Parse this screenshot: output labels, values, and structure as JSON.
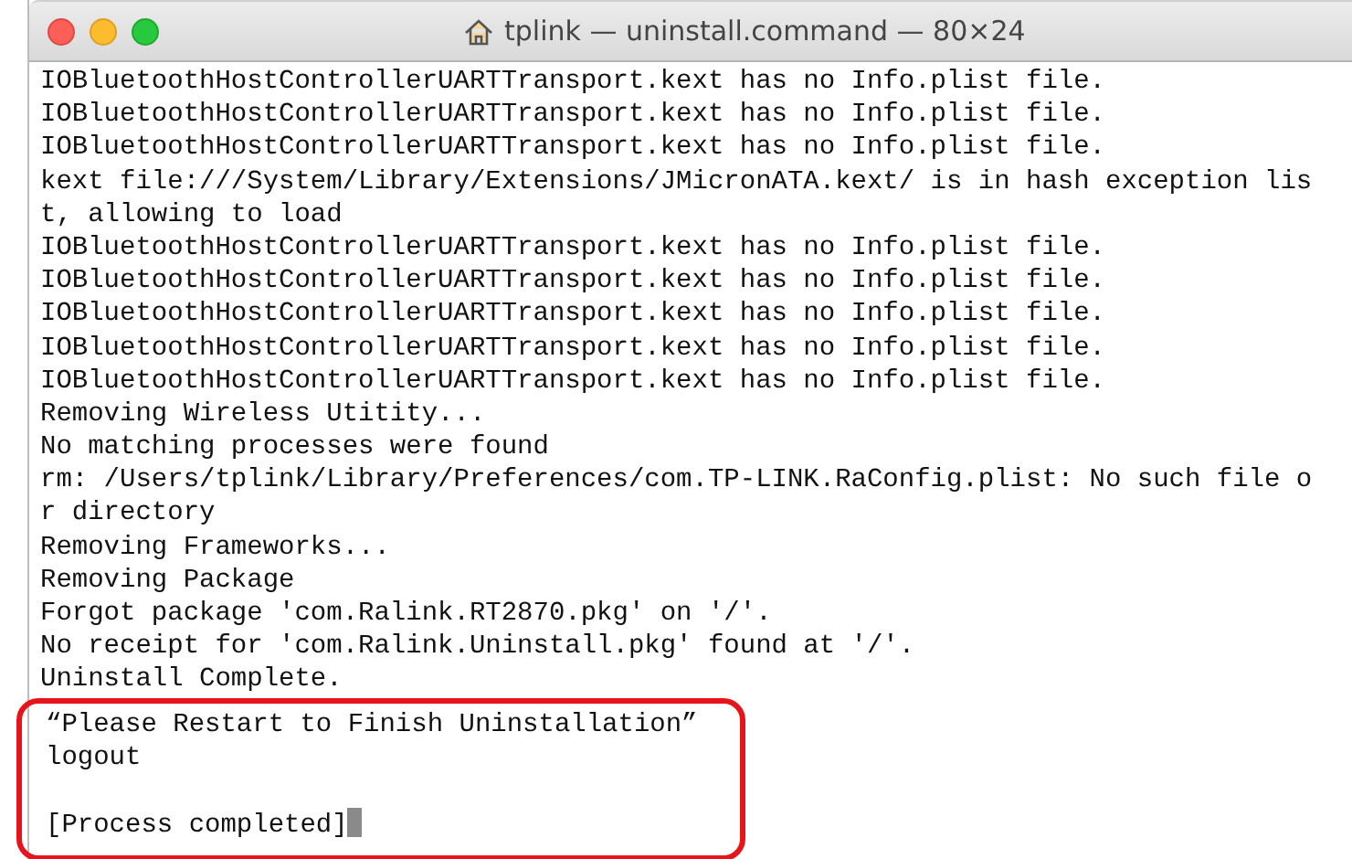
{
  "window": {
    "title": "tplink — uninstall.command — 80×24"
  },
  "terminal": {
    "cursor": true,
    "lines": [
      {
        "kind": "text",
        "text": "IOBluetoothHostControllerUARTTransport.kext has no Info.plist file.",
        "highlighted": false
      },
      {
        "kind": "text",
        "text": "IOBluetoothHostControllerUARTTransport.kext has no Info.plist file.",
        "highlighted": false
      },
      {
        "kind": "text",
        "text": "IOBluetoothHostControllerUARTTransport.kext has no Info.plist file.",
        "highlighted": false
      },
      {
        "kind": "text",
        "text": "kext file:///System/Library/Extensions/JMicronATA.kext/ is in hash exception lis",
        "highlighted": false
      },
      {
        "kind": "text",
        "text": "t, allowing to load",
        "highlighted": false
      },
      {
        "kind": "text",
        "text": "IOBluetoothHostControllerUARTTransport.kext has no Info.plist file.",
        "highlighted": false
      },
      {
        "kind": "text",
        "text": "IOBluetoothHostControllerUARTTransport.kext has no Info.plist file.",
        "highlighted": false
      },
      {
        "kind": "text",
        "text": "IOBluetoothHostControllerUARTTransport.kext has no Info.plist file.",
        "highlighted": false
      },
      {
        "kind": "text",
        "text": "IOBluetoothHostControllerUARTTransport.kext has no Info.plist file.",
        "highlighted": false
      },
      {
        "kind": "text",
        "text": "IOBluetoothHostControllerUARTTransport.kext has no Info.plist file.",
        "highlighted": false
      },
      {
        "kind": "text",
        "text": "Removing Wireless Utitity...",
        "highlighted": false
      },
      {
        "kind": "text",
        "text": "No matching processes were found",
        "highlighted": false
      },
      {
        "kind": "text",
        "text": "rm: /Users/tplink/Library/Preferences/com.TP-LINK.RaConfig.plist: No such file o",
        "highlighted": false
      },
      {
        "kind": "text",
        "text": "r directory",
        "highlighted": false
      },
      {
        "kind": "text",
        "text": "Removing Frameworks...",
        "highlighted": false
      },
      {
        "kind": "text",
        "text": "Removing Package",
        "highlighted": false
      },
      {
        "kind": "text",
        "text": "Forgot package 'com.Ralink.RT2870.pkg' on '/'.",
        "highlighted": false
      },
      {
        "kind": "text",
        "text": "No receipt for 'com.Ralink.Uninstall.pkg' found at '/'.",
        "highlighted": false
      },
      {
        "kind": "text",
        "text": "Uninstall Complete.",
        "highlighted": false
      },
      {
        "kind": "text",
        "text": "“Please Restart to Finish Uninstallation”",
        "highlighted": true
      },
      {
        "kind": "text",
        "text": "logout",
        "highlighted": true
      },
      {
        "kind": "blank",
        "highlighted": true
      },
      {
        "kind": "text",
        "text": "[Process completed]",
        "highlighted": true
      }
    ]
  }
}
